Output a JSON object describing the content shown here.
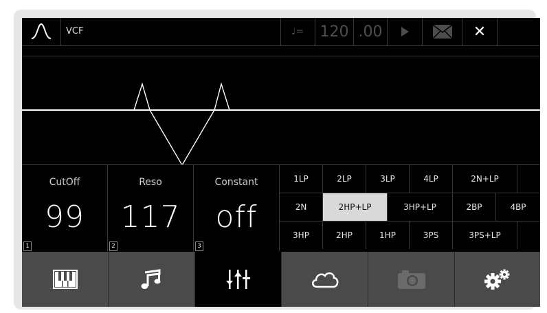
{
  "header": {
    "app_icon": "filter-curve-icon",
    "title": "VCF",
    "tempo_icon_label": "♩=",
    "tempo_value": "120",
    "tempo_decimal": ".00",
    "play_icon": "play-icon",
    "mail_icon": "mail-icon",
    "close_label": "✕"
  },
  "knobs": [
    {
      "label": "CutOff",
      "value": "99",
      "index": "1"
    },
    {
      "label": "Reso",
      "value": "117",
      "index": "2"
    },
    {
      "label": "Constant",
      "value": "off",
      "index": "3"
    }
  ],
  "filter_types": {
    "selected": "2HP+LP",
    "rows": [
      [
        "1LP",
        "2LP",
        "3LP",
        "4LP",
        "2N+LP"
      ],
      [
        "2N",
        "2HP+LP",
        "3HP+LP",
        "2BP",
        "4BP"
      ],
      [
        "3HP",
        "2HP",
        "1HP",
        "3PS",
        "3PS+LP"
      ]
    ]
  },
  "bottom_nav": [
    {
      "icon": "piano-keys-icon",
      "active": false
    },
    {
      "icon": "music-note-icon",
      "active": false
    },
    {
      "icon": "mixer-sliders-icon",
      "active": true
    },
    {
      "icon": "cloud-icon",
      "active": false
    },
    {
      "icon": "camera-icon",
      "active": false,
      "disabled": true
    },
    {
      "icon": "gears-icon",
      "active": false
    }
  ],
  "colors": {
    "screen_bg": "#000000",
    "nav_bg": "#4a4a4a",
    "selected_cell": "#d9d9d9",
    "graph_line": "#ffffff"
  }
}
